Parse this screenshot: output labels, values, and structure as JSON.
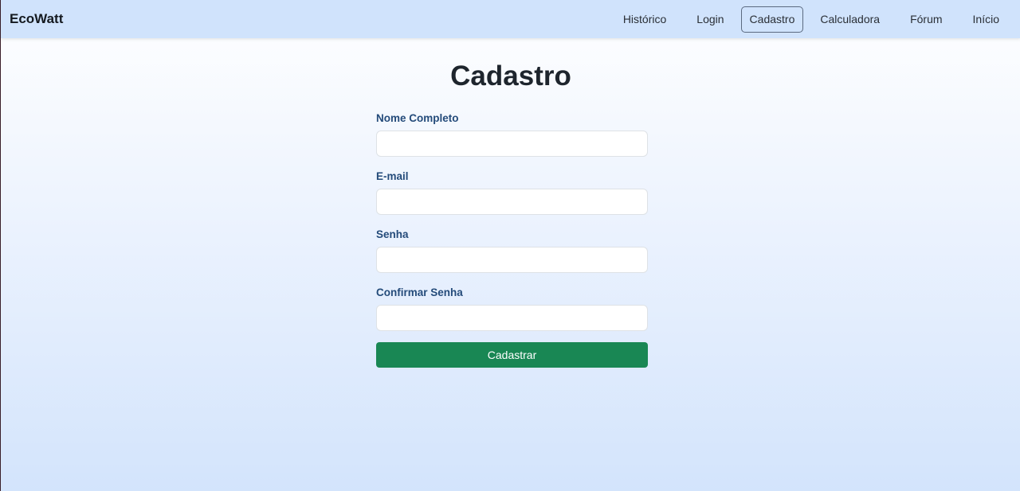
{
  "navbar": {
    "brand": "EcoWatt",
    "links": [
      {
        "label": "Histórico"
      },
      {
        "label": "Login"
      },
      {
        "label": "Cadastro",
        "active": true
      },
      {
        "label": "Calculadora"
      },
      {
        "label": "Fórum"
      },
      {
        "label": "Início"
      }
    ]
  },
  "page": {
    "title": "Cadastro"
  },
  "form": {
    "fields": [
      {
        "label": "Nome Completo",
        "value": "",
        "placeholder": ""
      },
      {
        "label": "E-mail",
        "value": "",
        "placeholder": ""
      },
      {
        "label": "Senha",
        "value": "",
        "placeholder": ""
      },
      {
        "label": "Confirmar Senha",
        "value": "",
        "placeholder": ""
      }
    ],
    "submit_label": "Cadastrar"
  },
  "colors": {
    "navbar_bg": "#d0e3fc",
    "label": "#244b7a",
    "submit_bg": "#198754"
  }
}
